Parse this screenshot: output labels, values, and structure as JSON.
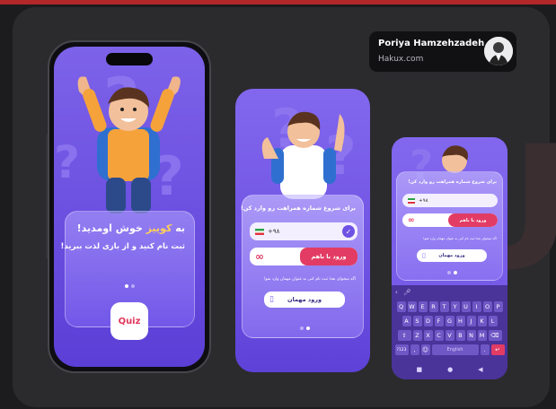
{
  "author": {
    "name": "Poriya Hamzehzadeh",
    "site": "Hakux.com"
  },
  "colors": {
    "accent": "#6e52e4",
    "red": "#e23c64",
    "background": "#2b2b2e"
  },
  "phone_onboarding": {
    "welcome_prefix": "به ",
    "brand": "کوییز",
    "welcome_suffix": " خوش اومدید!",
    "subtitle": "ثبت نام کنید و از بازی لذت ببرید!",
    "logo_text": "Quiz"
  },
  "phone_login": {
    "prompt": "برای شروع شماره همراهت رو وارد کن!",
    "country_code": "+۹۸",
    "login_button": "ورود با باهم",
    "guest_note": "اگه میخوای بعدا ثبت نام کنی به عنوان مهمان وارد شو!",
    "guest_button": "ورود مهمان"
  },
  "phone_keyboard": {
    "prompt": "برای شروع شماره همراهت رو وارد کن!",
    "country_code": "+۹۸",
    "login_button": "ورود با باهم",
    "guest_note": "اگه میخوای بعدا ثبت نام کنی به عنوان مهمان وارد شو!",
    "guest_button": "ورود مهمان",
    "keys_row1": [
      "Q",
      "W",
      "E",
      "R",
      "T",
      "Y",
      "U",
      "I",
      "O",
      "P"
    ],
    "keys_row2": [
      "A",
      "S",
      "D",
      "F",
      "G",
      "H",
      "J",
      "K",
      "L"
    ],
    "keys_row3": [
      "Z",
      "X",
      "C",
      "V",
      "B",
      "N",
      "M"
    ],
    "space_label": "English",
    "num_key": "?123"
  }
}
